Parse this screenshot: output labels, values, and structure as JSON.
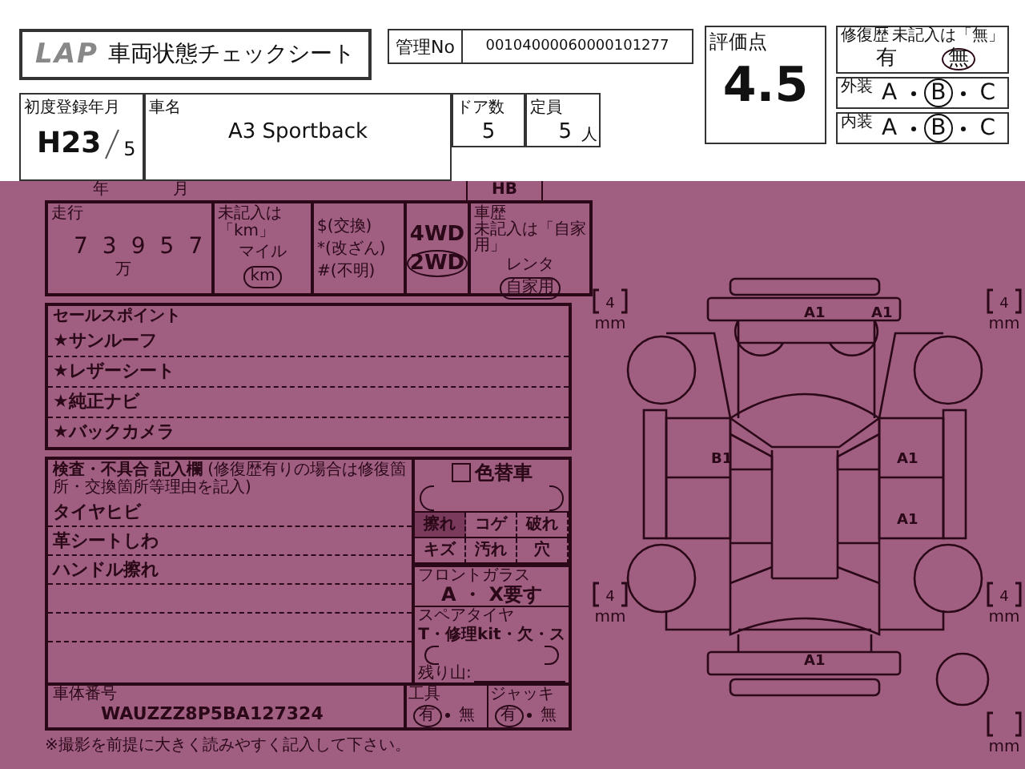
{
  "header": {
    "logo": "LAP",
    "title": "車両状態チェックシート",
    "management_no": {
      "label": "管理No",
      "value": "00104000060000101277"
    }
  },
  "score": {
    "label": "評価点",
    "value": "4.5"
  },
  "repair_history": {
    "label": "修復歴",
    "note": "未記入は「無」",
    "options": [
      {
        "label": "有",
        "selected": false
      },
      {
        "label": "無",
        "selected": true
      }
    ]
  },
  "exterior": {
    "label": "外装",
    "options": [
      {
        "label": "A",
        "selected": false
      },
      {
        "label": "B",
        "selected": true
      },
      {
        "label": "C",
        "selected": false
      }
    ]
  },
  "interior": {
    "label": "内装",
    "options": [
      {
        "label": "A",
        "selected": false
      },
      {
        "label": "B",
        "selected": true
      },
      {
        "label": "C",
        "selected": false
      }
    ]
  },
  "registration": {
    "label": "初度登録年月",
    "era_year": "H23",
    "month": "5",
    "year_unit": "年",
    "month_unit": "月"
  },
  "car_name": {
    "label": "車名",
    "value": "A3 Sportback"
  },
  "doors": {
    "label": "ドア数",
    "value": "5"
  },
  "capacity": {
    "label": "定員",
    "value": "5",
    "unit": "人"
  },
  "body_type": {
    "value": "HB"
  },
  "mileage": {
    "label": "走行",
    "digits": [
      "7",
      "3",
      "9",
      "5",
      "7"
    ],
    "ten_thousand_unit": "万",
    "unit_note": "未記入は「km」",
    "units": [
      {
        "label": "マイル",
        "selected": false
      },
      {
        "label": "km",
        "selected": true
      }
    ],
    "flags": [
      "$(交換)",
      "*(改ざん)",
      "#(不明)"
    ]
  },
  "drive": {
    "options": [
      {
        "label": "4WD",
        "selected": false
      },
      {
        "label": "2WD",
        "selected": true
      }
    ]
  },
  "usage": {
    "label": "車歴",
    "note": "未記入は「自家用」",
    "options": [
      {
        "label": "レンタ",
        "selected": false
      },
      {
        "label": "自家用",
        "selected": true
      }
    ]
  },
  "sales_points": {
    "label": "セールスポイント",
    "items": [
      "★サンルーフ",
      "★レザーシート",
      "★純正ナビ",
      "★バックカメラ"
    ]
  },
  "inspection": {
    "label": "検査・不具合 記入欄",
    "note": "(修復歴有りの場合は修復箇所・交換箇所等理由を記入)",
    "items": [
      "タイヤヒビ",
      "革シートしわ",
      "ハンドル擦れ"
    ],
    "vin": {
      "label": "車体番号",
      "value": "WAUZZZ8P5BA127324"
    }
  },
  "interior_damage": {
    "color_change": {
      "label": "色替車",
      "checked": false
    },
    "marks": [
      {
        "label": "擦れ",
        "selected": true
      },
      {
        "label": "コゲ",
        "selected": false
      },
      {
        "label": "破れ",
        "selected": false
      },
      {
        "label": "キズ",
        "selected": false
      },
      {
        "label": "汚れ",
        "selected": false
      },
      {
        "label": "穴",
        "selected": false
      }
    ]
  },
  "front_glass": {
    "label": "フロントガラス",
    "value": "A ・ X要す"
  },
  "spare_tire": {
    "label": "スペアタイヤ",
    "value": "T・修理kit・欠・ス",
    "tread_label": "残り山:"
  },
  "tools": {
    "label": "工具",
    "options": [
      {
        "label": "有",
        "selected": true
      },
      {
        "label": "無",
        "selected": false
      }
    ]
  },
  "jack": {
    "label": "ジャッキ",
    "options": [
      {
        "label": "有",
        "selected": true
      },
      {
        "label": "無",
        "selected": false
      }
    ]
  },
  "footnote": "※撮影を前提に大きく読みやすく記入して下さい。",
  "diagram": {
    "damage_marks": [
      {
        "label": "A1"
      },
      {
        "label": "A1"
      },
      {
        "label": "B1"
      },
      {
        "label": "A1"
      },
      {
        "label": "A1"
      },
      {
        "label": "A1"
      }
    ],
    "treads": [
      {
        "depth": "4",
        "unit": "mm"
      },
      {
        "depth": "4",
        "unit": "mm"
      },
      {
        "depth": "4",
        "unit": "mm"
      },
      {
        "depth": "4",
        "unit": "mm"
      },
      {
        "unit": "mm"
      }
    ]
  }
}
